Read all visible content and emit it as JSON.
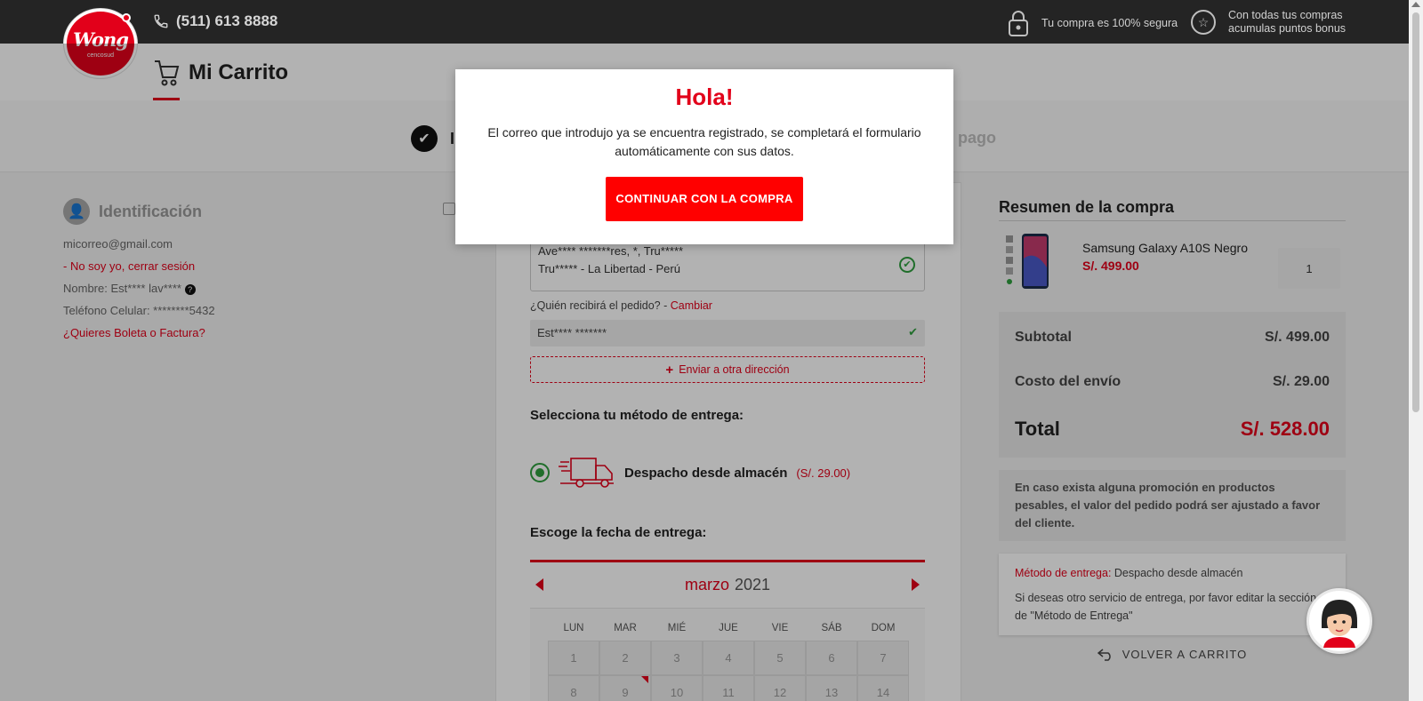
{
  "topbar": {
    "phone": "(511) 613 8888",
    "secure_text": "Tu compra es 100% segura",
    "points_line1": "Con todas tus compras",
    "points_line2": "acumulas puntos bonus"
  },
  "logo": {
    "name": "Wong",
    "sub": "cencosud"
  },
  "header": {
    "title": "Mi Carrito"
  },
  "steps": {
    "first_initial": "I",
    "last_partial": "e pago"
  },
  "identification": {
    "title": "Identificación",
    "email": "micorreo@gmail.com",
    "logout": "- No soy yo, cerrar sesión",
    "name": "Nombre: Est**** lav****",
    "phone": "Teléfono Celular:  ********5432",
    "invoice": "¿Quieres Boleta o Factura?"
  },
  "shipping": {
    "address_line1": "Ave**** *******res, *, Tru*****",
    "address_line2": "Tru***** - La Libertad - Perú",
    "receiver_question": "¿Quién recibirá el pedido? - ",
    "receiver_change": "Cambiar",
    "receiver_name": "Est****  *******",
    "other_address": "Enviar a otra dirección",
    "delivery_title": "Selecciona tu método de entrega:",
    "delivery_name": "Despacho desde almacén",
    "delivery_price": "(S/. 29.00)",
    "date_title": "Escoge la fecha de entrega:"
  },
  "calendar": {
    "month": "marzo",
    "year": "2021",
    "weekdays": [
      "LUN",
      "MAR",
      "MIÉ",
      "JUE",
      "VIE",
      "SÁB",
      "DOM"
    ],
    "dates": [
      "1",
      "2",
      "3",
      "4",
      "5",
      "6",
      "7",
      "8",
      "9",
      "10",
      "11",
      "12",
      "13",
      "14"
    ]
  },
  "summary": {
    "title": "Resumen de la compra",
    "product_name": "Samsung Galaxy A10S Negro",
    "product_price": "S/. 499.00",
    "quantity": "1",
    "subtotal_label": "Subtotal",
    "subtotal_value": "S/. 499.00",
    "shipping_label": "Costo del envío",
    "shipping_value": "S/. 29.00",
    "total_label": "Total",
    "total_value": "S/. 528.00",
    "promo_note": "En caso exista alguna promoción en productos pesables, el valor del pedido podrá ser ajustado a favor del cliente.",
    "method_label": "Método de entrega:",
    "method_value": " Despacho desde almacén",
    "method_note": "Si deseas otro servicio de entrega, por favor editar la sección de \"Método de Entrega\"",
    "back": "VOLVER A CARRITO"
  },
  "modal": {
    "title": "Hola!",
    "message": "El correo que introdujo ya se encuentra registrado, se completará el formulario automáticamente con sus datos.",
    "button": "CONTINUAR CON LA COMPRA"
  },
  "colors": {
    "brand_red": "#e2001a",
    "button_red": "#ff0000",
    "success_green": "#2e9e3e",
    "topbar": "#242424"
  }
}
